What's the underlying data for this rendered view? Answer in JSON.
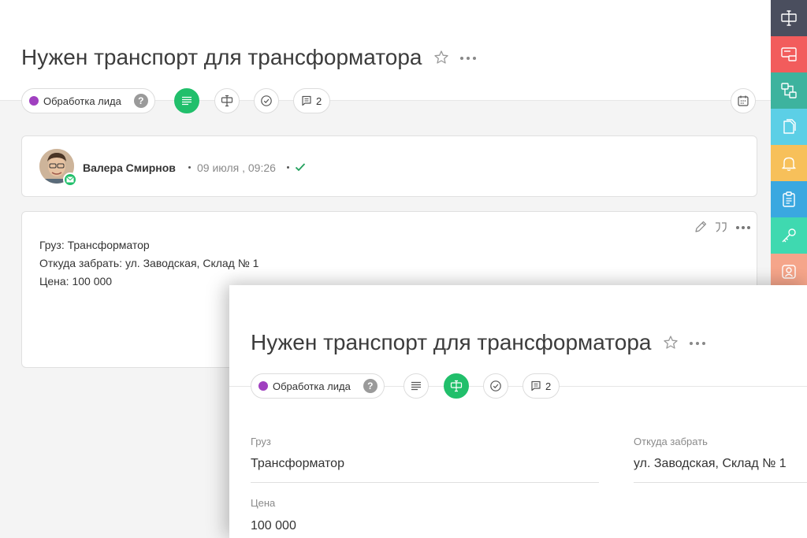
{
  "page": {
    "title": "Нужен транспорт для трансформатора",
    "status": {
      "label": "Обработка лида",
      "color": "#a040c0",
      "help_icon": "?"
    },
    "toolbar": {
      "comments_count": "2",
      "active_color": "#21bf6b"
    }
  },
  "activity": {
    "author": "Валера Смирнов",
    "date": "09 июля , 09:26",
    "text_lines": [
      "Груз: Трансформатор",
      "Откуда забрать: ул. Заводская, Склад № 1",
      "Цена: 100 000"
    ]
  },
  "sidebar": {
    "items": [
      {
        "icon": "fields-icon",
        "color": "#4a4e5e"
      },
      {
        "icon": "message-icon",
        "color": "#f25c5c"
      },
      {
        "icon": "relations-icon",
        "color": "#3db39e"
      },
      {
        "icon": "documents-icon",
        "color": "#5ccfe6"
      },
      {
        "icon": "bell-icon",
        "color": "#f7c05a"
      },
      {
        "icon": "clipboard-icon",
        "color": "#3aa8e0"
      },
      {
        "icon": "key-icon",
        "color": "#3fd9b0"
      },
      {
        "icon": "contact-icon",
        "color": "#f5a58a"
      }
    ]
  },
  "overlay": {
    "title": "Нужен транспорт для трансформатора",
    "status": {
      "label": "Обработка лида",
      "help_icon": "?"
    },
    "comments_count": "2",
    "fields": {
      "cargo": {
        "label": "Груз",
        "value": "Трансформатор"
      },
      "pickup": {
        "label": "Откуда забрать",
        "value": "ул. Заводская, Склад № 1"
      },
      "price": {
        "label": "Цена",
        "value": "100 000"
      }
    }
  }
}
